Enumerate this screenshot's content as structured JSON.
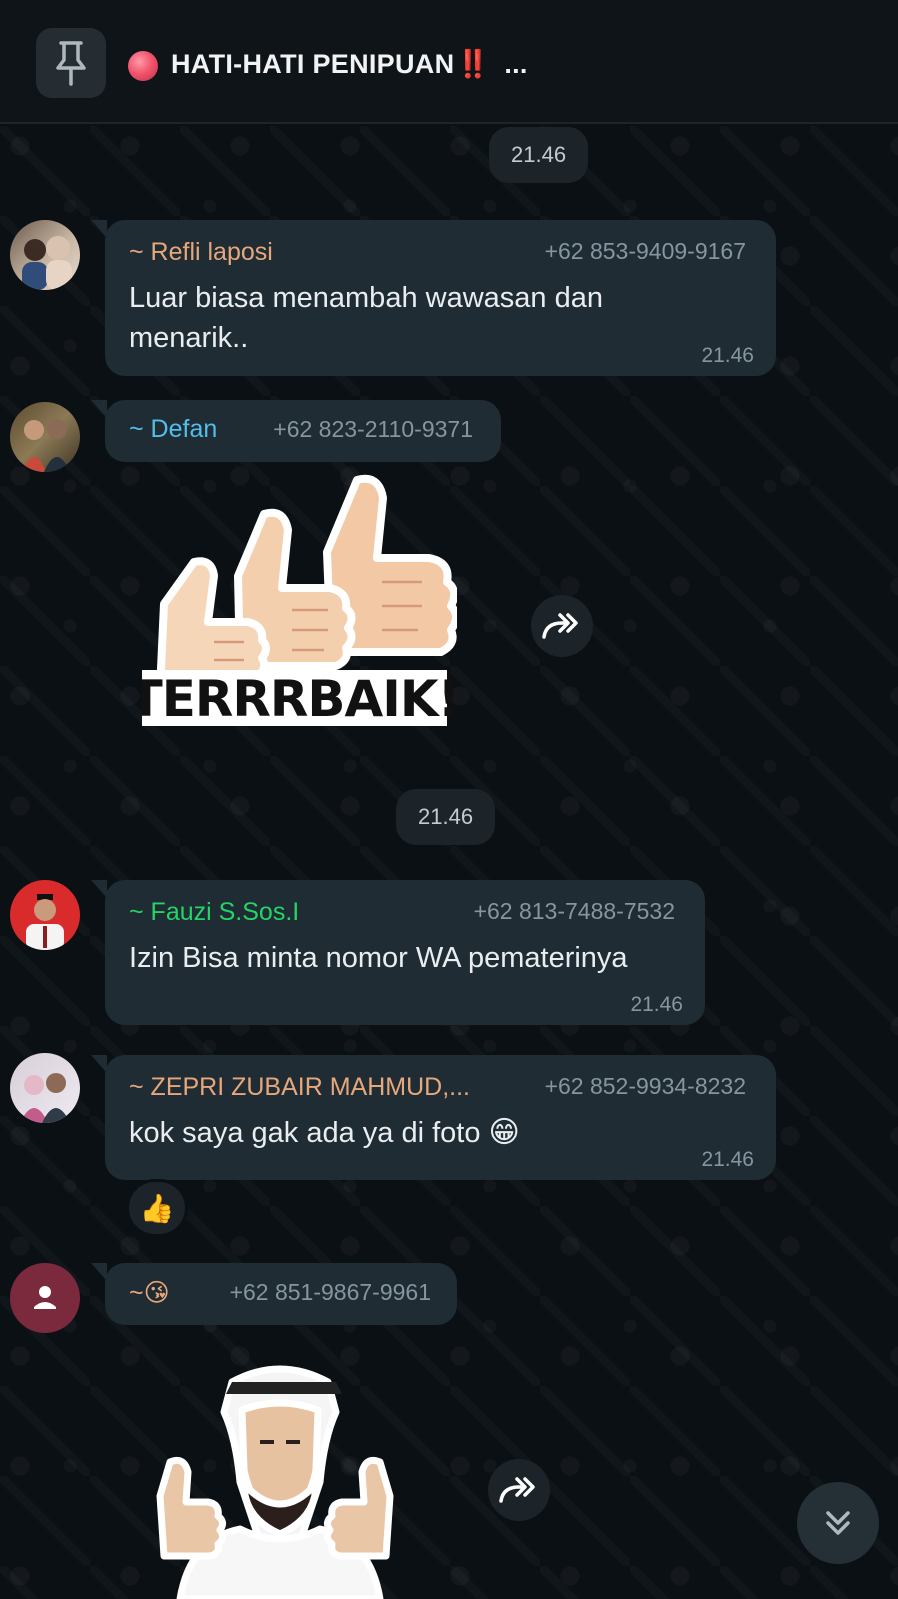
{
  "pinned": {
    "title": "HATI-HATI PENIPUAN",
    "emphasis": "‼️",
    "more": "..."
  },
  "timestamps": {
    "top": "21.46",
    "middle": "21.46"
  },
  "messages": [
    {
      "sender": "~ Refli laposi",
      "sender_color": "#e7a77c",
      "phone": "+62 853-9409-9167",
      "text_line1": "Luar biasa menambah wawasan dan",
      "text_line2": "menarik..",
      "time": "21.46"
    },
    {
      "sender": "~ Defan",
      "sender_color": "#53bdeb",
      "phone": "+62 823-2110-9371",
      "sticker": "thumbs-up-sticker",
      "sticker_caption": "TERRRBAIK!"
    },
    {
      "sender": "~ Fauzi S.Sos.I",
      "sender_color": "#25d366",
      "phone": "+62 813-7488-7532",
      "text_line1": "Izin Bisa minta nomor WA pematerinya",
      "time": "21.46"
    },
    {
      "sender": "~ ZEPRI ZUBAIR MAHMUD,...",
      "sender_color": "#e7a77c",
      "phone": "+62 852-9934-8232",
      "text_line1": "kok saya gak ada ya di foto",
      "emoji": "😁",
      "time": "21.46",
      "reaction": "👍"
    },
    {
      "sender": "~😘",
      "sender_color": "#e7a77c",
      "phone": "+62 851-9867-9961",
      "sticker": "arab-man-thumbs-up-sticker"
    }
  ]
}
